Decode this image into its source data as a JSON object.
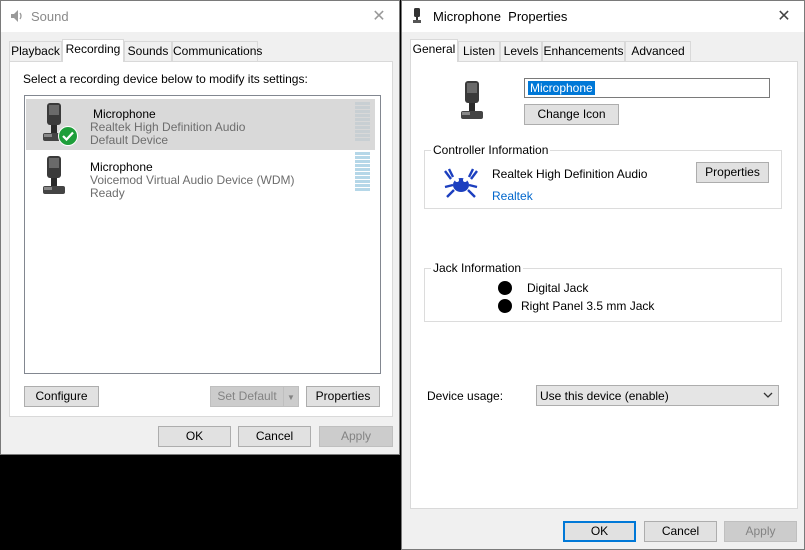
{
  "sound": {
    "title": "Sound",
    "tabs": [
      "Playback",
      "Recording",
      "Sounds",
      "Communications"
    ],
    "instruction": "Select a recording device below to modify its settings:",
    "devices": [
      {
        "name": "Microphone",
        "driver": "Realtek High Definition Audio",
        "status": "Default Device",
        "selected": true,
        "default": true
      },
      {
        "name": "Microphone",
        "driver": "Voicemod Virtual Audio Device (WDM)",
        "status": "Ready",
        "selected": false,
        "default": false
      }
    ],
    "buttons": {
      "configure": "Configure",
      "set_default": "Set Default",
      "properties": "Properties",
      "ok": "OK",
      "cancel": "Cancel",
      "apply": "Apply"
    }
  },
  "props": {
    "title": "Microphone  Properties",
    "tabs": [
      "General",
      "Listen",
      "Levels",
      "Enhancements",
      "Advanced"
    ],
    "name_value": "Microphone",
    "change_icon": "Change Icon",
    "controller_group": "Controller Information",
    "controller_name": "Realtek High Definition Audio",
    "controller_properties": "Properties",
    "vendor_link": "Realtek",
    "jack_group": "Jack Information",
    "jacks": [
      "Digital Jack",
      "Right Panel 3.5 mm Jack"
    ],
    "device_usage_label": "Device usage:",
    "device_usage_value": "Use this device (enable)",
    "buttons": {
      "ok": "OK",
      "cancel": "Cancel",
      "apply": "Apply"
    }
  },
  "colors": {
    "accent": "#0078d7",
    "link": "#0066cc",
    "check": "#1e9e3a"
  },
  "icons": [
    "sound-app-icon",
    "microphone-icon",
    "check-icon",
    "realtek-crab-icon",
    "chevron-down-icon",
    "close-icon"
  ]
}
